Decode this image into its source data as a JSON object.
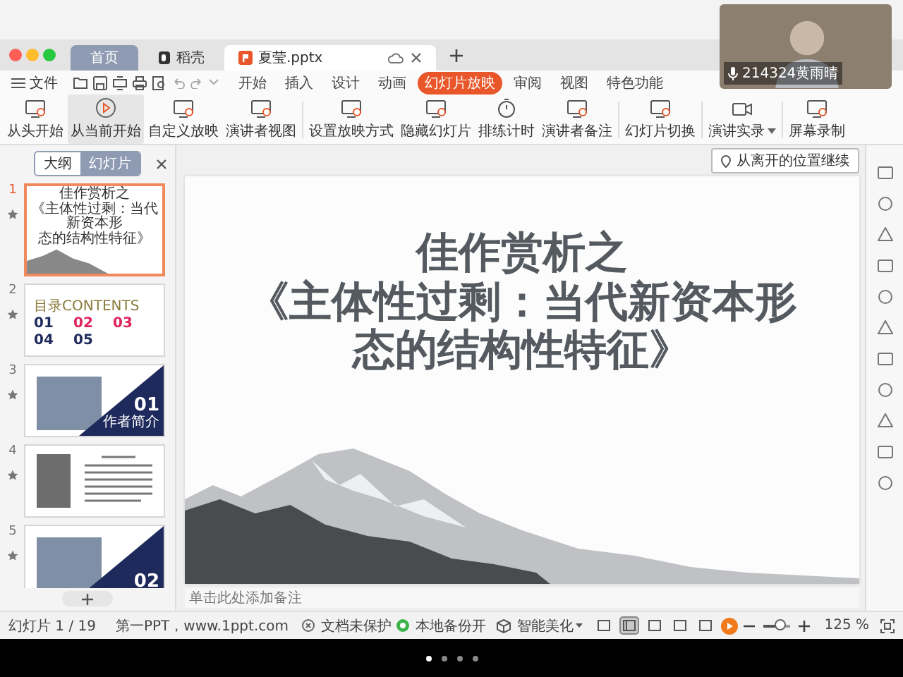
{
  "window": {
    "tabs": [
      {
        "label": "首页",
        "kind": "home",
        "selected": false
      },
      {
        "label": "稻壳",
        "kind": "docer",
        "selected": false
      },
      {
        "label": "夏莹.pptx",
        "kind": "file",
        "selected": true
      }
    ]
  },
  "menu": {
    "file": "文件",
    "ribbon_tabs": [
      {
        "label": "开始",
        "selected": false
      },
      {
        "label": "插入",
        "selected": false
      },
      {
        "label": "设计",
        "selected": false
      },
      {
        "label": "动画",
        "selected": false
      },
      {
        "label": "幻灯片放映",
        "selected": true
      },
      {
        "label": "审阅",
        "selected": false
      },
      {
        "label": "视图",
        "selected": false
      },
      {
        "label": "特色功能",
        "selected": false
      }
    ]
  },
  "toolbar": [
    {
      "label": "从头开始",
      "hovered": false,
      "dropdown": false
    },
    {
      "label": "从当前开始",
      "hovered": true,
      "dropdown": false
    },
    {
      "label": "自定义放映",
      "hovered": false,
      "dropdown": false
    },
    {
      "label": "演讲者视图",
      "hovered": false,
      "dropdown": false
    },
    {
      "label": "设置放映方式",
      "hovered": false,
      "dropdown": false
    },
    {
      "label": "隐藏幻灯片",
      "hovered": false,
      "dropdown": false
    },
    {
      "label": "排练计时",
      "hovered": false,
      "dropdown": false
    },
    {
      "label": "演讲者备注",
      "hovered": false,
      "dropdown": false
    },
    {
      "label": "幻灯片切换",
      "hovered": false,
      "dropdown": false
    },
    {
      "label": "演讲实录",
      "hovered": false,
      "dropdown": true
    },
    {
      "label": "屏幕录制",
      "hovered": false,
      "dropdown": false
    }
  ],
  "video_call": {
    "name": "214324黄雨晴"
  },
  "panel": {
    "tabs": [
      {
        "label": "大纲",
        "selected": false
      },
      {
        "label": "幻灯片",
        "selected": true
      }
    ],
    "slides": [
      {
        "number": "1",
        "kind": "title",
        "selected": true,
        "lines": [
          "佳作赏析之",
          "《主体性过剩：当代新资本形",
          "态的结构性特征》"
        ]
      },
      {
        "number": "2",
        "kind": "contents",
        "selected": false,
        "heading": "目录CONTENTS",
        "items": [
          {
            "label": "01",
            "color": "#1f2a5c"
          },
          {
            "label": "02",
            "color": "#e0245e"
          },
          {
            "label": "03",
            "color": "#e0245e"
          },
          {
            "label": "04",
            "color": "#1f2a5c"
          },
          {
            "label": "05",
            "color": "#1f2a5c"
          }
        ]
      },
      {
        "number": "3",
        "kind": "section",
        "selected": false,
        "section": "01",
        "caption": "作者简介"
      },
      {
        "number": "4",
        "kind": "profile",
        "selected": false
      },
      {
        "number": "5",
        "kind": "section",
        "selected": false,
        "section": "02"
      }
    ]
  },
  "slide": {
    "resume_button": "从离开的位置继续",
    "title_lines": [
      "佳作赏析之",
      "《主体性过剩：当代新资本形",
      "态的结构性特征》"
    ]
  },
  "notes": {
    "placeholder": "单击此处添加备注"
  },
  "status_bar": {
    "slide_count": "幻灯片 1 / 19",
    "template": "第一PPT，www.1ppt.com",
    "protection": "文档未保护",
    "backup": "本地备份开",
    "beautify": "智能美化",
    "view_buttons": [
      {
        "selected": false
      },
      {
        "selected": true
      },
      {
        "selected": false
      },
      {
        "selected": false
      },
      {
        "selected": false
      }
    ],
    "zoom": {
      "level": 0.6,
      "reading": "125 %"
    }
  },
  "page_dots": [
    {
      "selected": true
    },
    {
      "selected": false
    },
    {
      "selected": false
    },
    {
      "selected": false
    }
  ]
}
